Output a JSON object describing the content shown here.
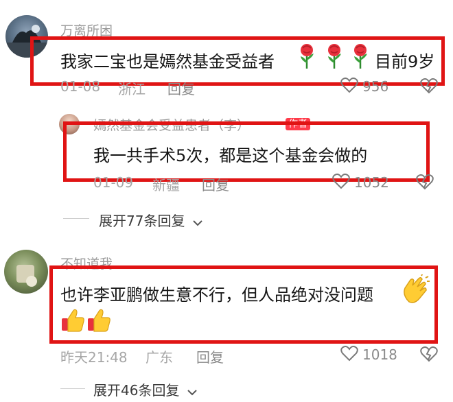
{
  "comments": [
    {
      "username": "万离所困",
      "text": "我家二宝也是嫣然基金受益者",
      "text_suffix": "目前9岁",
      "emoji": "rose-emoji",
      "time": "01-08",
      "location": "浙江",
      "reply_label": "回复",
      "likes": "956",
      "reply": {
        "username": "嫣然基金会受益患者（李）",
        "badge": "作者",
        "text": "我一共手术5次，都是这个基金会做的",
        "time": "01-09",
        "location": "新疆",
        "reply_label": "回复",
        "likes": "1052"
      },
      "expand_label": "展开77条回复"
    },
    {
      "username": "不知道我",
      "text": "也许李亚鹏做生意不行，但人品绝对没问题",
      "emoji": "clap-emoji",
      "emoji2": "thumbs-up-emoji",
      "time": "昨天21:48",
      "location": "广东",
      "reply_label": "回复",
      "likes": "1018",
      "expand_label": "展开46条回复"
    }
  ],
  "colors": {
    "highlight_box": "#e01414",
    "meta_text": "#a6a6a6",
    "author_badge": "#ff3b4a"
  }
}
